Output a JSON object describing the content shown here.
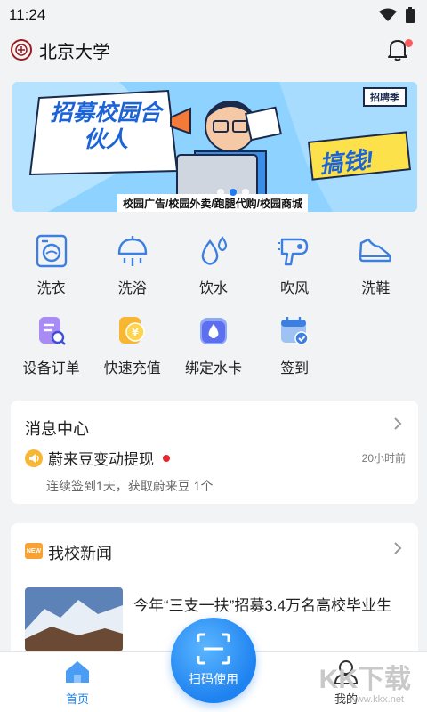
{
  "status": {
    "time": "11:24"
  },
  "header": {
    "school_name": "北京大学"
  },
  "banner": {
    "headline": "招募校园合伙人",
    "cta": "搞钱!",
    "tag": "招聘季",
    "caption": "校园广告/校园外卖/跑腿代购/校园商城",
    "dots": 3,
    "active_dot": 1
  },
  "services_row1": [
    {
      "label": "洗衣",
      "icon": "washing-machine-icon"
    },
    {
      "label": "洗浴",
      "icon": "shower-icon"
    },
    {
      "label": "饮水",
      "icon": "water-drops-icon"
    },
    {
      "label": "吹风",
      "icon": "hair-dryer-icon"
    },
    {
      "label": "洗鞋",
      "icon": "shoe-icon"
    }
  ],
  "services_row2": [
    {
      "label": "设备订单",
      "icon": "order-icon"
    },
    {
      "label": "快速充值",
      "icon": "recharge-icon"
    },
    {
      "label": "绑定水卡",
      "icon": "water-card-icon"
    },
    {
      "label": "签到",
      "icon": "checkin-calendar-icon"
    }
  ],
  "messages": {
    "title": "消息中心",
    "item": {
      "title": "蔚来豆变动提现",
      "time": "20小时前",
      "desc": "连续签到1天，获取蔚来豆 1个"
    }
  },
  "news": {
    "title": "我校新闻",
    "badge": "NEW",
    "item": {
      "text": "今年“三支一扶”招募3.4万名高校毕业生"
    }
  },
  "tabbar": {
    "home": "首页",
    "scan": "扫码使用",
    "mine": "我的"
  },
  "watermark": {
    "text": "KK下载",
    "url": "www.kkx.net"
  },
  "colors": {
    "accent": "#1e82f0",
    "alert": "#e8262c",
    "background": "#f2f3f5"
  }
}
